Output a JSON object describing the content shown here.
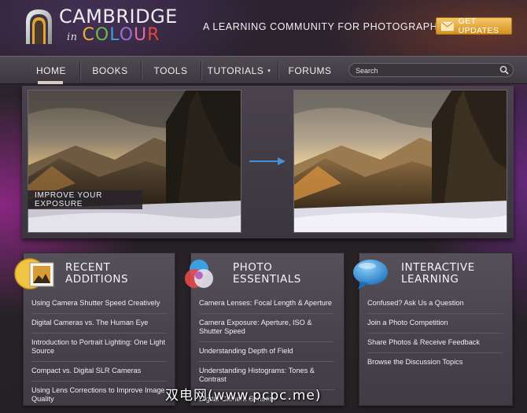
{
  "header": {
    "logo_line1": "CAMBRIDGE",
    "logo_in": "in",
    "logo_colour_letters": [
      "C",
      "O",
      "L",
      "O",
      "U",
      "R"
    ],
    "logo_colour_colors": [
      "#e8b23a",
      "#6dbb44",
      "#3aa3d8",
      "#9a6fd0",
      "#e26aa6",
      "#e0463f"
    ],
    "tagline": "A LEARNING COMMUNITY FOR PHOTOGRAPHERS",
    "updates_label": "GET UPDATES",
    "updates_icon": "envelope-icon"
  },
  "nav": {
    "items": [
      {
        "label": "HOME",
        "active": true
      },
      {
        "label": "BOOKS"
      },
      {
        "label": "TOOLS"
      },
      {
        "label": "TUTORIALS",
        "caret": "▾"
      },
      {
        "label": "FORUMS"
      }
    ],
    "search_placeholder": "Search",
    "search_icon": "search-icon"
  },
  "hero": {
    "caption": "IMPROVE YOUR EXPOSURE",
    "arrow_icon": "arrow-right-icon"
  },
  "cards": [
    {
      "title_line1": "RECENT",
      "title_line2": "ADDITIONS",
      "icon": "photo-frame-icon",
      "links": [
        "Using Camera Shutter Speed Creatively",
        "Digital Cameras vs. The Human Eye",
        "Introduction to Portrait Lighting: One Light Source",
        "Compact vs. Digital SLR Cameras",
        "Using Lens Corrections to Improve Image Quality"
      ]
    },
    {
      "title_line1": "PHOTO",
      "title_line2": "ESSENTIALS",
      "icon": "rgb-circles-icon",
      "links": [
        "Camera Lenses: Focal Length & Aperture",
        "Camera Exposure: Aperture, ISO & Shutter Speed",
        "Understanding Depth of Field",
        "Understanding Histograms: Tones & Contrast",
        "Digital Camera Sensors"
      ]
    },
    {
      "title_line1": "INTERACTIVE",
      "title_line2": "LEARNING",
      "icon": "speech-bubble-icon",
      "links": [
        "Confused? Ask Us a Question",
        "Join a Photo Competition",
        "Share Photos & Receive Feedback",
        "Browse the Discussion Topics"
      ]
    }
  ],
  "watermark": "双电网(www.pcpc.me)"
}
